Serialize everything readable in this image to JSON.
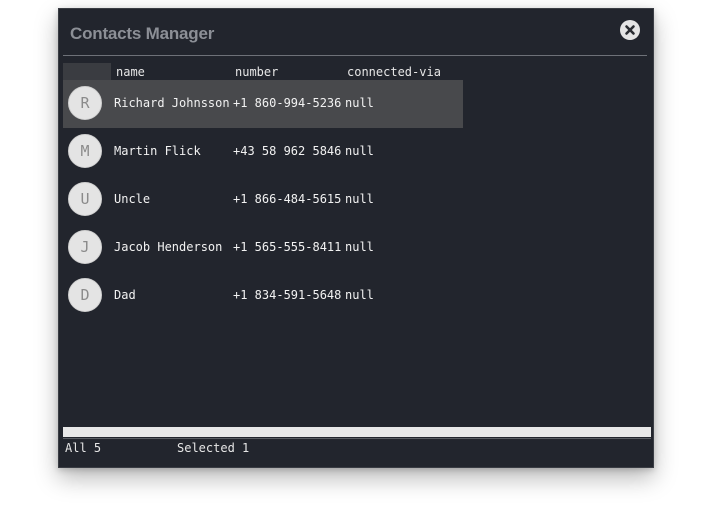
{
  "window": {
    "title": "Contacts Manager"
  },
  "table": {
    "columns": [
      "name",
      "number",
      "connected-via"
    ],
    "rows": [
      {
        "initial": "R",
        "name": "Richard Johnsson",
        "number": "+1 860-994-5236",
        "via": "null",
        "selected": true
      },
      {
        "initial": "M",
        "name": "Martin Flick",
        "number": "+43 58 962 5846",
        "via": "null",
        "selected": false
      },
      {
        "initial": "U",
        "name": "Uncle",
        "number": "+1 866-484-5615",
        "via": "null",
        "selected": false
      },
      {
        "initial": "J",
        "name": "Jacob Henderson",
        "number": "+1 565-555-8411",
        "via": "null",
        "selected": false
      },
      {
        "initial": "D",
        "name": "Dad",
        "number": "+1 834-591-5648",
        "via": "null",
        "selected": false
      }
    ]
  },
  "status": {
    "all": "All 5",
    "selected": "Selected 1"
  },
  "colors": {
    "window_bg": "#22252d",
    "selected_row": "#48494c",
    "title_text": "#8c8f96"
  },
  "icons": {
    "close": "close-icon"
  }
}
